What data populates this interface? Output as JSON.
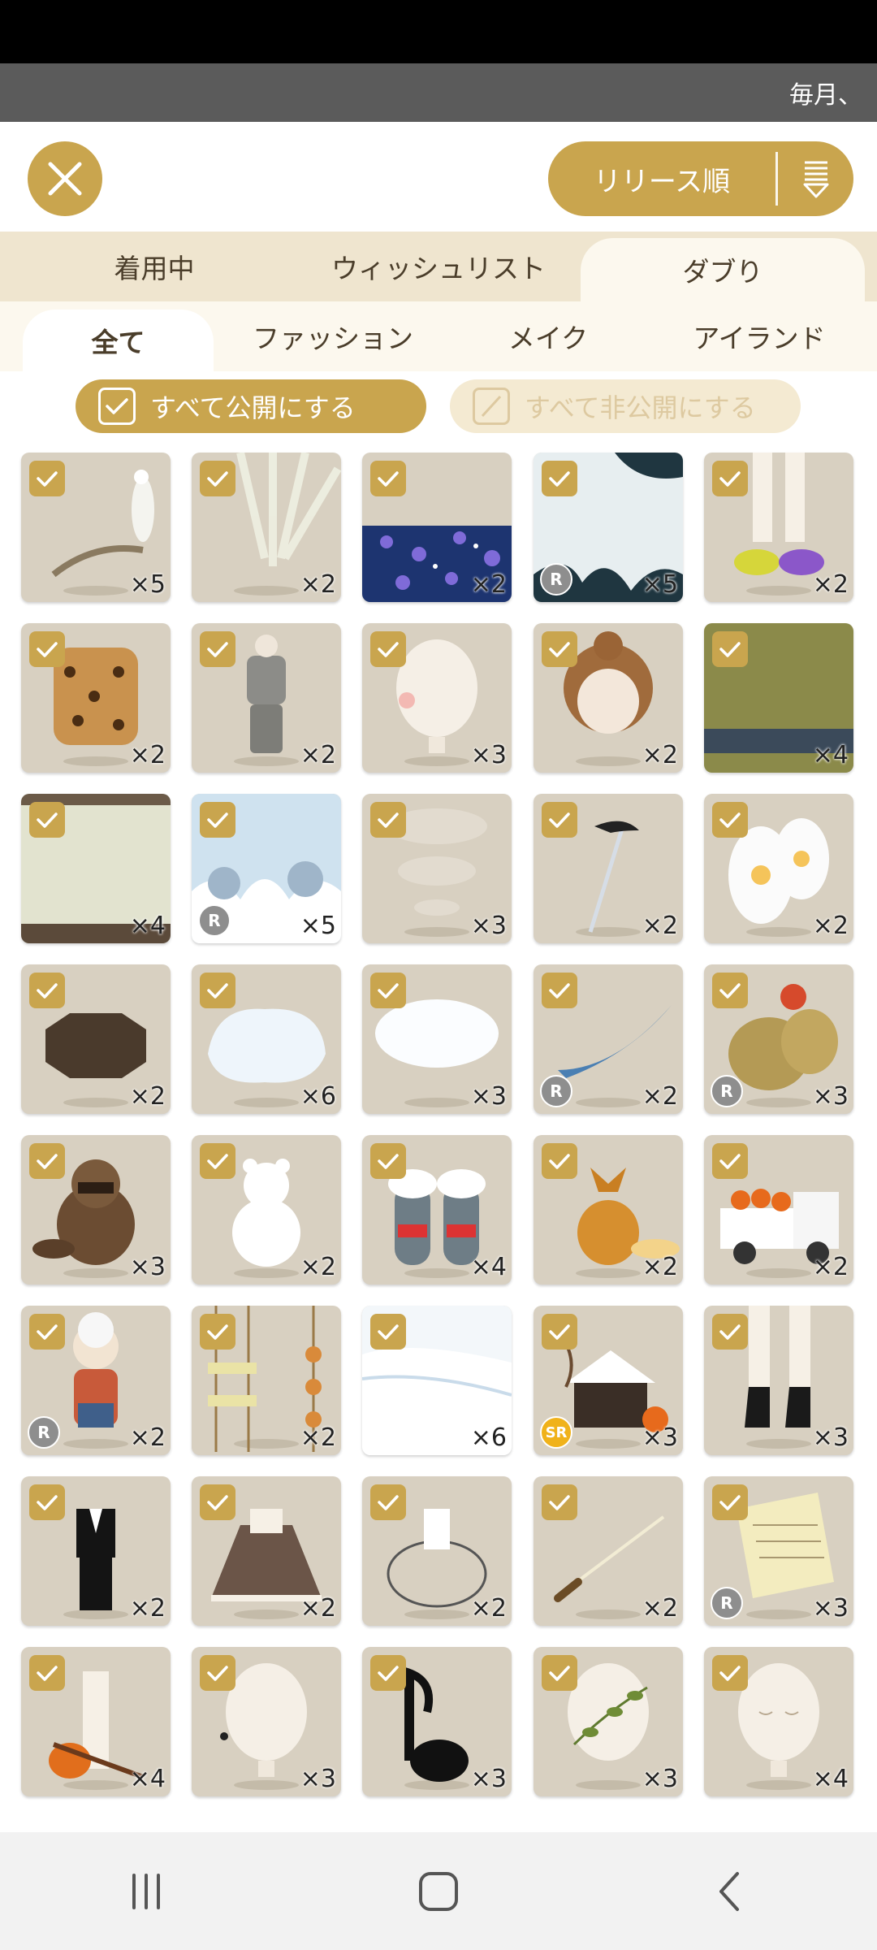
{
  "banner": {
    "text": "毎月、"
  },
  "header": {
    "sort_label": "リリース順"
  },
  "tabs_primary": [
    {
      "label": "着用中",
      "active": false
    },
    {
      "label": "ウィッシュリスト",
      "active": false
    },
    {
      "label": "ダブり",
      "active": true
    }
  ],
  "tabs_secondary": [
    {
      "label": "全て",
      "active": true
    },
    {
      "label": "ファッション",
      "active": false
    },
    {
      "label": "メイク",
      "active": false
    },
    {
      "label": "アイランド",
      "active": false
    }
  ],
  "toggles": {
    "publish_all": "すべて公開にする",
    "unpublish_all": "すべて非公開にする"
  },
  "colors": {
    "accent": "#c9a54e",
    "tab_bg": "#efe5cf",
    "card_bg": "#d8d0c1"
  },
  "items": [
    {
      "icon": "white-peacock-on-branch",
      "count": "×5",
      "rarity": ""
    },
    {
      "icon": "light-rays",
      "count": "×2",
      "rarity": ""
    },
    {
      "icon": "blue-flower-field",
      "count": "×2",
      "rarity": ""
    },
    {
      "icon": "night-jungle-silhouette",
      "count": "×5",
      "rarity": "R"
    },
    {
      "icon": "sneakers-with-socks",
      "count": "×2",
      "rarity": ""
    },
    {
      "icon": "leopard-print-outfit",
      "count": "×2",
      "rarity": ""
    },
    {
      "icon": "gray-sweatsuit",
      "count": "×2",
      "rarity": ""
    },
    {
      "icon": "blush-face",
      "count": "×3",
      "rarity": ""
    },
    {
      "icon": "brown-bun-hairstyle",
      "count": "×2",
      "rarity": ""
    },
    {
      "icon": "tatami-floor",
      "count": "×4",
      "rarity": ""
    },
    {
      "icon": "tatami-room-wall",
      "count": "×4",
      "rarity": ""
    },
    {
      "icon": "snowy-forest-background",
      "count": "×5",
      "rarity": "R"
    },
    {
      "icon": "steam-clouds",
      "count": "×3",
      "rarity": ""
    },
    {
      "icon": "crow-on-pole",
      "count": "×2",
      "rarity": ""
    },
    {
      "icon": "snow-lanterns",
      "count": "×2",
      "rarity": ""
    },
    {
      "icon": "wooden-octagon-table",
      "count": "×2",
      "rarity": ""
    },
    {
      "icon": "snow-pile",
      "count": "×6",
      "rarity": ""
    },
    {
      "icon": "snow-patch",
      "count": "×3",
      "rarity": ""
    },
    {
      "icon": "blue-feather",
      "count": "×2",
      "rarity": "R"
    },
    {
      "icon": "new-year-rice-bales",
      "count": "×3",
      "rarity": "R"
    },
    {
      "icon": "tanuki-figure",
      "count": "×3",
      "rarity": ""
    },
    {
      "icon": "snowman-bear",
      "count": "×2",
      "rarity": ""
    },
    {
      "icon": "jizo-statues-with-snow",
      "count": "×4",
      "rarity": ""
    },
    {
      "icon": "fox-figure",
      "count": "×2",
      "rarity": ""
    },
    {
      "icon": "kei-truck-with-persimmons",
      "count": "×2",
      "rarity": ""
    },
    {
      "icon": "grandma-figure",
      "count": "×2",
      "rarity": "R"
    },
    {
      "icon": "hanging-dried-persimmons",
      "count": "×2",
      "rarity": ""
    },
    {
      "icon": "snowy-ground",
      "count": "×6",
      "rarity": ""
    },
    {
      "icon": "snowy-house-persimmon-tree",
      "count": "×3",
      "rarity": "SR"
    },
    {
      "icon": "black-boots-with-socks",
      "count": "×3",
      "rarity": ""
    },
    {
      "icon": "black-tuxedo",
      "count": "×2",
      "rarity": ""
    },
    {
      "icon": "brown-lolita-dress",
      "count": "×2",
      "rarity": ""
    },
    {
      "icon": "white-crinoline-dress",
      "count": "×2",
      "rarity": ""
    },
    {
      "icon": "conductor-baton",
      "count": "×2",
      "rarity": ""
    },
    {
      "icon": "sheet-music",
      "count": "×3",
      "rarity": "R"
    },
    {
      "icon": "violin-and-pumpkin",
      "count": "×4",
      "rarity": ""
    },
    {
      "icon": "ear-piercing-face",
      "count": "×3",
      "rarity": ""
    },
    {
      "icon": "music-note",
      "count": "×3",
      "rarity": ""
    },
    {
      "icon": "ivy-face-paint",
      "count": "×3",
      "rarity": ""
    },
    {
      "icon": "closed-eyes-face",
      "count": "×4",
      "rarity": ""
    }
  ]
}
